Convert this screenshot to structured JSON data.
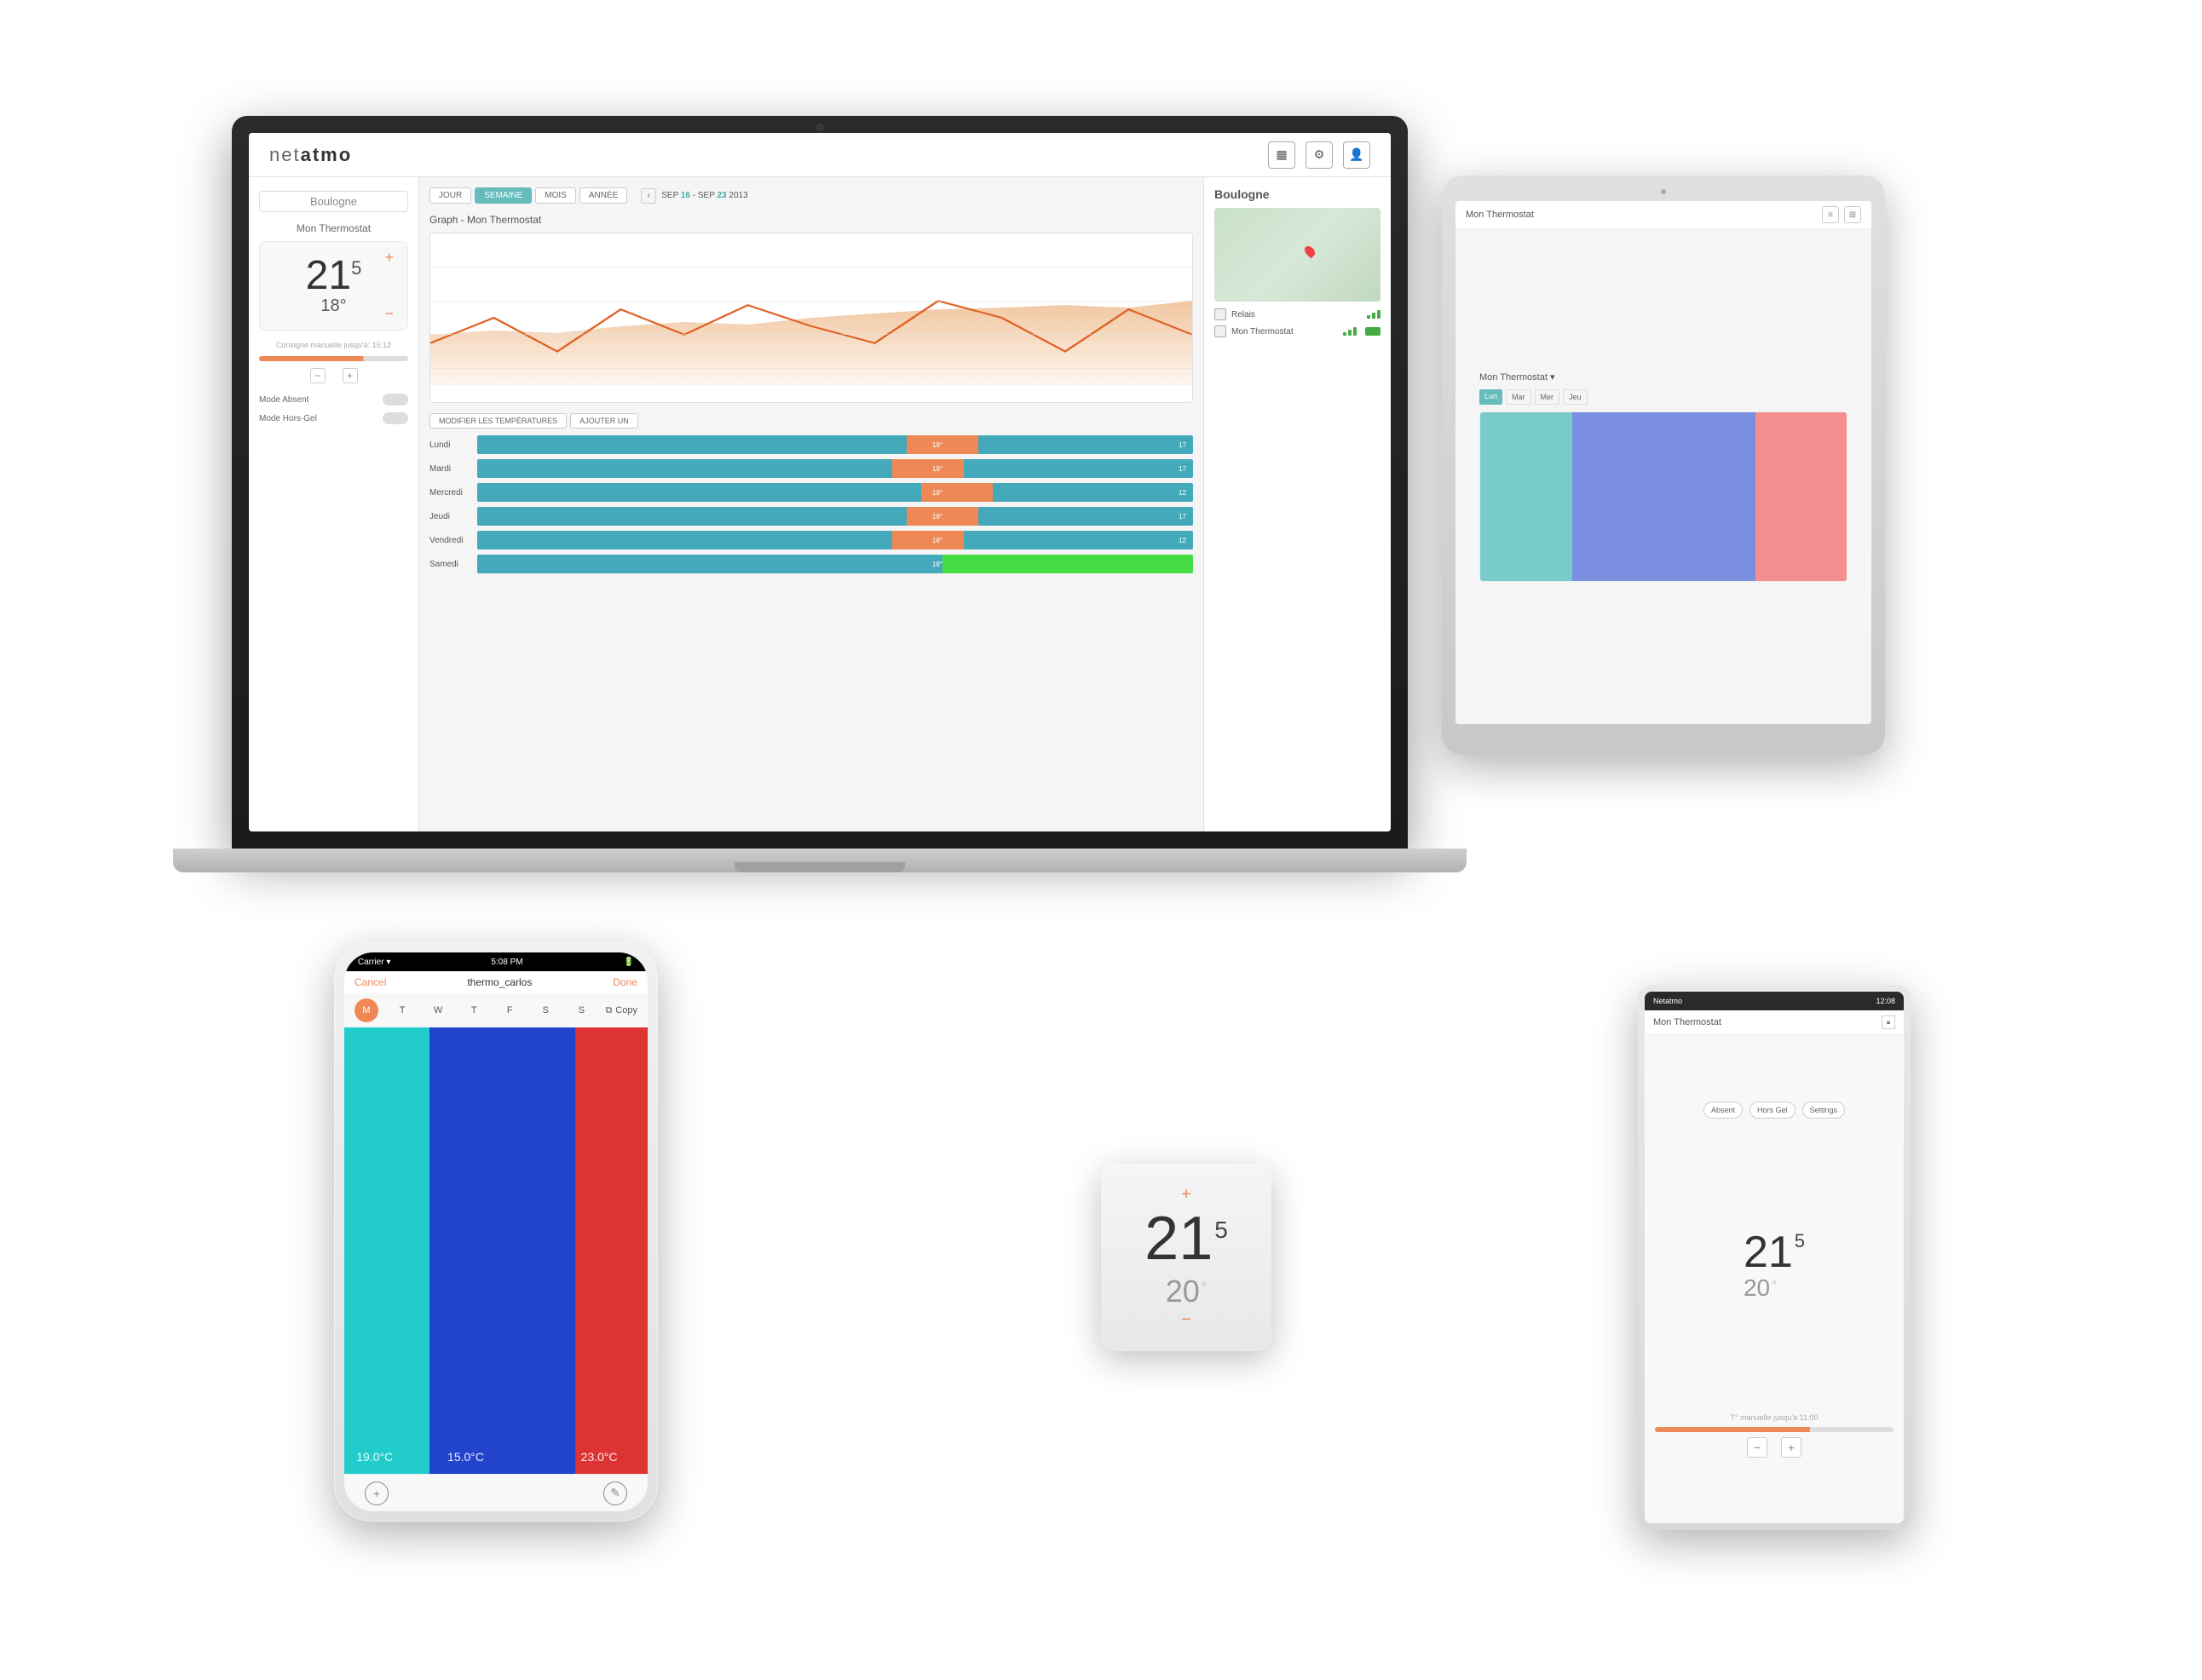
{
  "app": {
    "logo": "netatmo",
    "header_icons": [
      "bar-chart",
      "settings",
      "user"
    ],
    "location": "Boulogne",
    "thermostat_name": "Mon Thermostat",
    "temp_current": "21",
    "temp_sup": "5",
    "temp_small": "18",
    "temp_small_sup": "°",
    "consigne": "Consigne manuelle jusqu'à: 15:12",
    "mode_absent": "Mode Absent",
    "mode_hors_gel": "Mode Hors-Gel"
  },
  "time_tabs": [
    "JOUR",
    "SEMAINE",
    "MOIS",
    "ANNÉE"
  ],
  "active_tab": "SEMAINE",
  "date_range": "SEP 16 - SEP 23 2013",
  "graph_title": "Graph - Mon Thermostat",
  "schedule_tabs": [
    "MODIFIER LES TEMPÉRATURES",
    "AJOUTER UN"
  ],
  "days": [
    {
      "name": "Lundi",
      "temp": "18°"
    },
    {
      "name": "Mardi",
      "temp": "18°"
    },
    {
      "name": "Mercredi",
      "temp": "18°"
    },
    {
      "name": "Jeudi",
      "temp": "18°"
    },
    {
      "name": "Vendredi",
      "temp": "18°"
    },
    {
      "name": "Samedi",
      "temp": "18°"
    }
  ],
  "iphone": {
    "status_left": "Carrier ▾",
    "status_time": "5:08 PM",
    "cancel": "Cancel",
    "title": "thermo_carlos",
    "done": "Done",
    "day_letters": [
      "M",
      "T",
      "W",
      "T",
      "F",
      "S",
      "S"
    ],
    "active_day": "M",
    "copy": "Copy",
    "temps": [
      "19.0°C",
      "15.0°C",
      "23.0°C"
    ]
  },
  "hw_thermostat": {
    "temp_big": "21",
    "temp_sup": "5",
    "temp_small": "20",
    "temp_small_sup": "°"
  },
  "android": {
    "status_left": "Netatmo",
    "status_right": "12:08",
    "title": "Mon Thermostat",
    "temp_big": "21",
    "temp_sup": "5",
    "temp_small": "20",
    "temp_small_sup": "°",
    "consigne": "T° manuelle jusqu'à 11:00",
    "mode_btns": [
      "Absent",
      "Hors Gel",
      "Settings"
    ]
  },
  "copy_button": "Copy"
}
